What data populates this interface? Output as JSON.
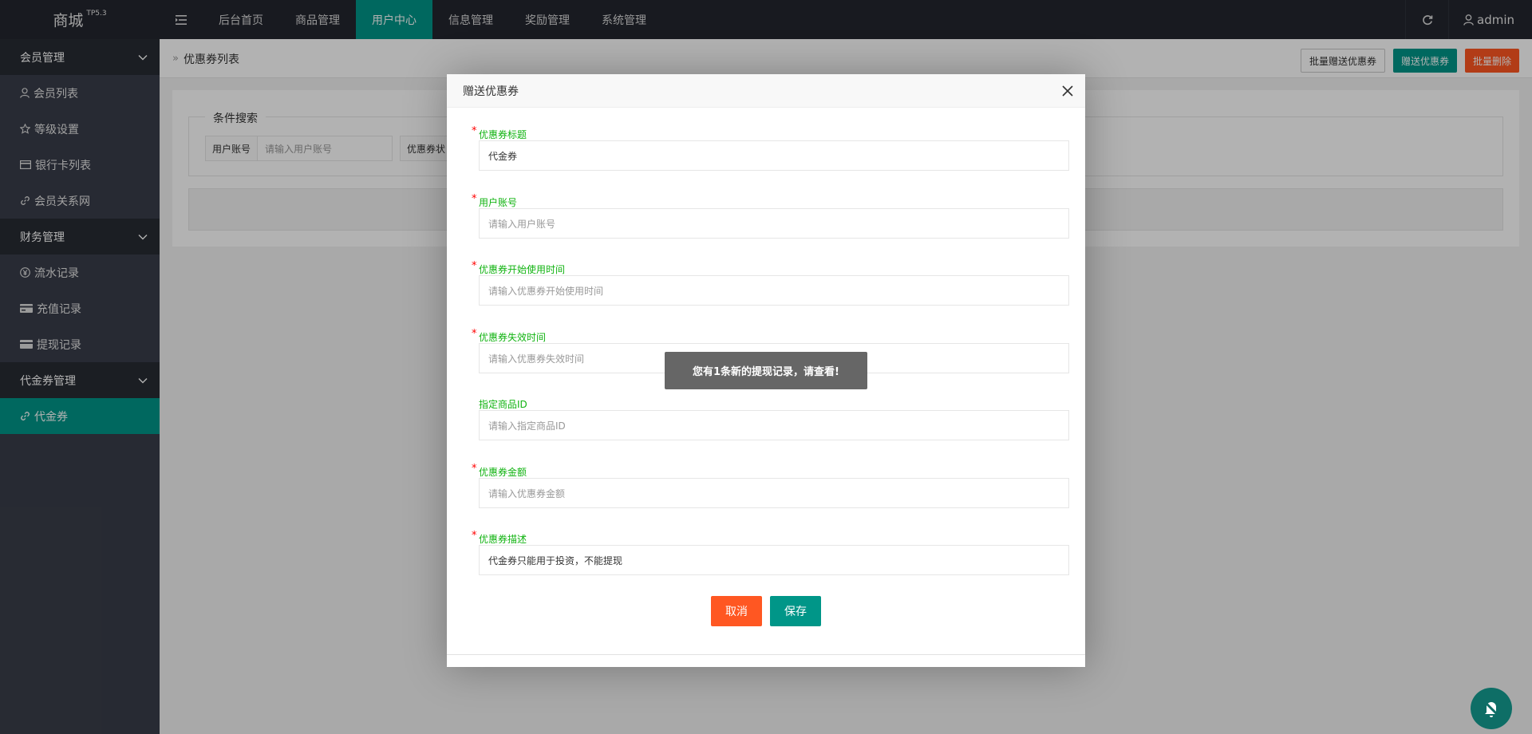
{
  "app": {
    "logo": "商城",
    "version": "TP5.3"
  },
  "topnav": {
    "items": [
      {
        "label": "后台首页",
        "active": false
      },
      {
        "label": "商品管理",
        "active": false
      },
      {
        "label": "用户中心",
        "active": true
      },
      {
        "label": "信息管理",
        "active": false
      },
      {
        "label": "奖励管理",
        "active": false
      },
      {
        "label": "系统管理",
        "active": false
      }
    ],
    "user": "admin"
  },
  "sidebar": {
    "groups": [
      {
        "label": "会员管理",
        "items": [
          "会员列表",
          "等级设置",
          "银行卡列表",
          "会员关系网"
        ]
      },
      {
        "label": "财务管理",
        "items": [
          "流水记录",
          "充值记录",
          "提现记录"
        ]
      },
      {
        "label": "代金券管理",
        "items": [
          "代金券"
        ]
      }
    ],
    "active_item": "代金券"
  },
  "main": {
    "breadcrumb": "优惠券列表",
    "buttons": {
      "batch_gift": "批量赠送优惠券",
      "gift": "赠送优惠券",
      "batch_delete": "批量删除"
    },
    "search": {
      "legend": "条件搜索",
      "account_label": "用户账号",
      "account_placeholder": "请输入用户账号",
      "status_label": "优惠券状"
    }
  },
  "modal": {
    "title": "赠送优惠券",
    "fields": [
      {
        "label": "优惠券标题",
        "required": true,
        "value": "代金券",
        "placeholder": ""
      },
      {
        "label": "用户账号",
        "required": true,
        "value": "",
        "placeholder": "请输入用户账号"
      },
      {
        "label": "优惠券开始使用时间",
        "required": true,
        "value": "",
        "placeholder": "请输入优惠券开始使用时间"
      },
      {
        "label": "优惠券失效时间",
        "required": true,
        "value": "",
        "placeholder": "请输入优惠券失效时间"
      },
      {
        "label": "指定商品ID",
        "required": false,
        "value": "",
        "placeholder": "请输入指定商品ID"
      },
      {
        "label": "优惠券金额",
        "required": true,
        "value": "",
        "placeholder": "请输入优惠券金额"
      },
      {
        "label": "优惠券描述",
        "required": true,
        "value": "代金券只能用于投资，不能提现",
        "placeholder": ""
      }
    ],
    "cancel_label": "取消",
    "save_label": "保存"
  },
  "toast": {
    "message": "您有1条新的提现记录，请查看!"
  },
  "colors": {
    "accent": "#009688",
    "danger": "#ff5722",
    "header": "#23262e",
    "sidebar": "#393d49"
  },
  "icons": [
    "menu-fold-icon",
    "refresh-icon",
    "user-icon",
    "star-icon",
    "card-icon",
    "link-icon",
    "yen-icon",
    "close-icon",
    "chevron-down-icon",
    "bell-off-icon"
  ]
}
